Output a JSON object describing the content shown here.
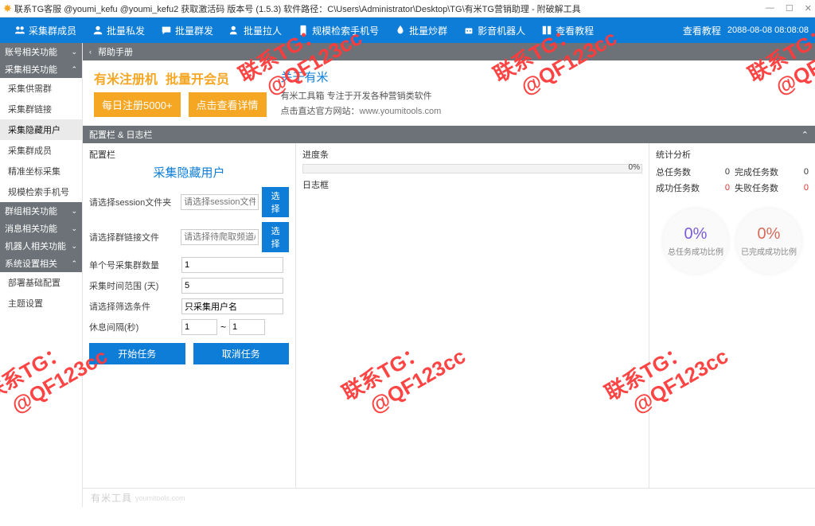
{
  "titlebar": {
    "text": "联系TG客服 @youmi_kefu @youmi_kefu2 获取激活码 版本号 (1.5.3) 软件路径：C\\Users\\Administrator\\Desktop\\TG\\有米TG营销助理 - 附破解工具"
  },
  "toolbar": {
    "items": [
      {
        "label": "采集群成员",
        "icon": "people-icon"
      },
      {
        "label": "批量私发",
        "icon": "user-icon"
      },
      {
        "label": "批量群发",
        "icon": "chat-icon"
      },
      {
        "label": "批量拉人",
        "icon": "adduser-icon"
      },
      {
        "label": "规模检索手机号",
        "icon": "phone-icon"
      },
      {
        "label": "批量炒群",
        "icon": "flame-icon"
      },
      {
        "label": "影音机器人",
        "icon": "robot-icon"
      },
      {
        "label": "查看教程",
        "icon": "book-icon"
      }
    ],
    "right_link": "查看教程",
    "datetime": "2088-08-08 08:08:08"
  },
  "sidebar": {
    "groups": [
      {
        "title": "账号相关功能",
        "items": []
      },
      {
        "title": "采集相关功能",
        "items": [
          {
            "label": "采集供需群"
          },
          {
            "label": "采集群链接"
          },
          {
            "label": "采集隐藏用户",
            "selected": true
          },
          {
            "label": "采集群成员"
          },
          {
            "label": "精准坐标采集"
          },
          {
            "label": "规模检索手机号"
          }
        ]
      },
      {
        "title": "群组相关功能",
        "items": []
      },
      {
        "title": "消息相关功能",
        "items": []
      },
      {
        "title": "机器人相关功能",
        "items": []
      },
      {
        "title": "系统设置相关",
        "items": [
          {
            "label": "部署基础配置"
          },
          {
            "label": "主题设置"
          }
        ]
      }
    ]
  },
  "helpbar": {
    "label": "帮助手册"
  },
  "promo": {
    "h1": "有米注册机",
    "h2": "批量开会员",
    "btn1": "每日注册5000+",
    "btn2": "点击查看详情",
    "about_title": "关于有米",
    "about_line1": "有米工具箱 专注于开发各种营销类软件",
    "about_line2_prefix": "点击直达官方网站：",
    "about_url": "www.youmitools.com"
  },
  "cfgbar": {
    "label": "配置栏 & 日志栏"
  },
  "col1": {
    "title": "配置栏",
    "big_title": "采集隐藏用户",
    "rows": {
      "r1_label": "请选择session文件夹",
      "r1_ph": "请选择session文件夹路",
      "r1_btn": "选择",
      "r2_label": "请选择群链接文件",
      "r2_ph": "请选择待爬取频道/群组",
      "r2_btn": "选择",
      "r3_label": "单个号采集群数量",
      "r3_val": "1",
      "r4_label": "采集时间范围 (天)",
      "r4_val": "5",
      "r5_label": "请选择筛选条件",
      "r5_val": "只采集用户名",
      "r6_label": "休息间隔(秒)",
      "r6_a": "1",
      "r6_b": "1"
    },
    "start": "开始任务",
    "cancel": "取消任务"
  },
  "col2": {
    "title": "进度条",
    "pct": "0%",
    "log_label": "日志框"
  },
  "col3": {
    "title": "统计分析",
    "total_label": "总任务数",
    "total_val": "0",
    "done_label": "完成任务数",
    "done_val": "0",
    "succ_label": "成功任务数",
    "succ_val": "0",
    "fail_label": "失败任务数",
    "fail_val": "0",
    "circ1_pct": "0%",
    "circ1_lbl": "总任务成功比例",
    "circ2_pct": "0%",
    "circ2_lbl": "已完成成功比例"
  },
  "footer": {
    "logo": "有米工具",
    "url": "youmitools.com"
  },
  "watermark": "联系TG：\n   @QF123cc"
}
